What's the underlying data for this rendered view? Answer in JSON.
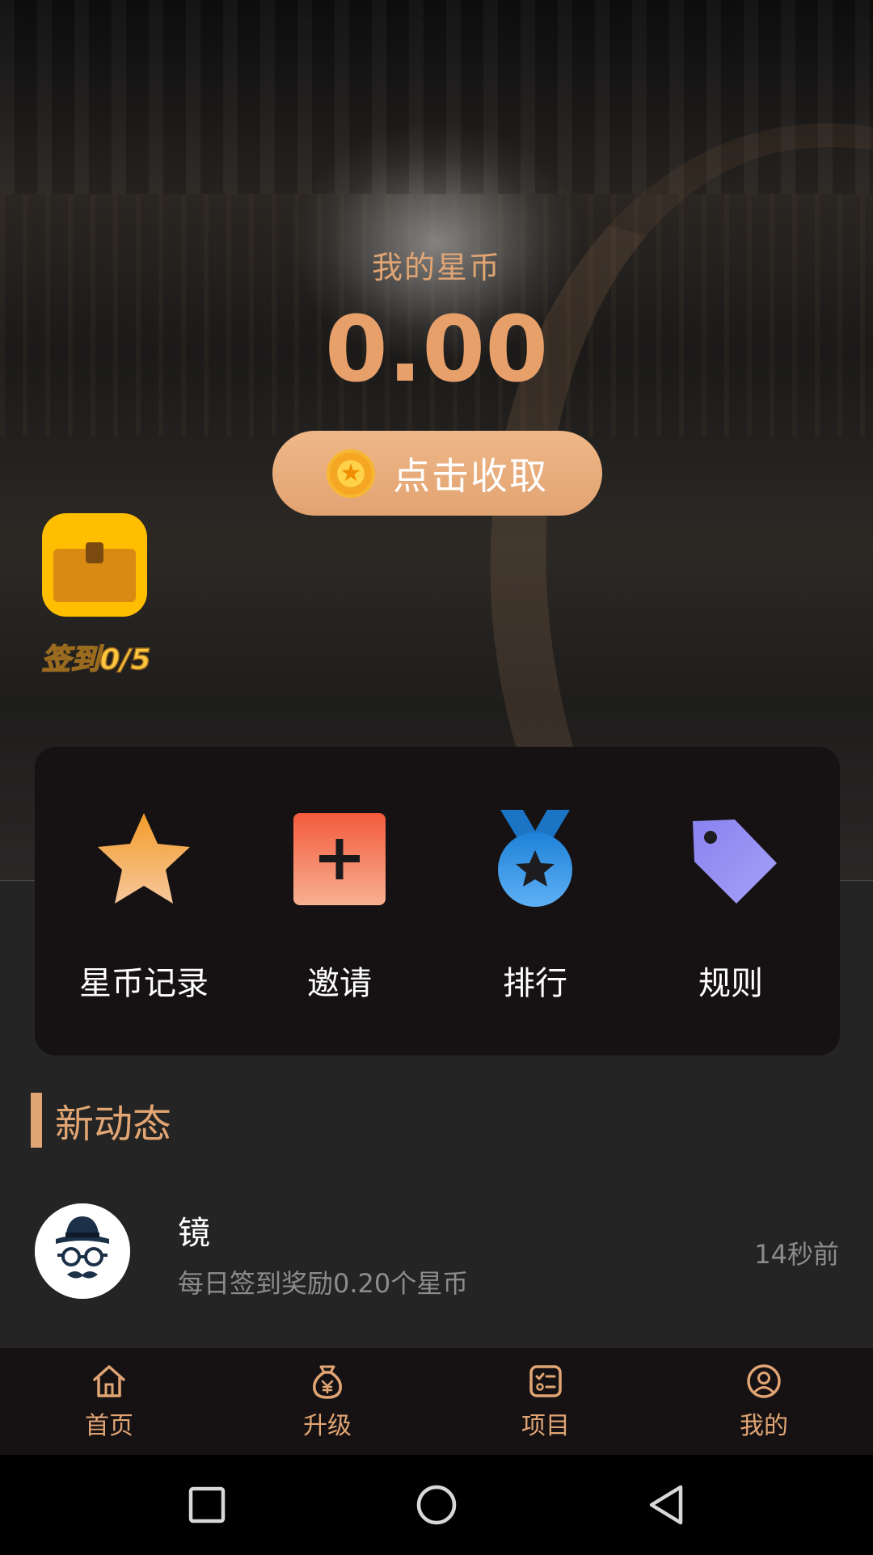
{
  "hero": {
    "stars_label": "我的星币",
    "stars_amount": "0.00",
    "collect_button": "点击收取",
    "checkin_label": "签到0/5"
  },
  "actions": [
    {
      "label": "星币记录",
      "icon": "star-icon"
    },
    {
      "label": "邀请",
      "icon": "plus-square-icon"
    },
    {
      "label": "排行",
      "icon": "medal-icon"
    },
    {
      "label": "规则",
      "icon": "tag-icon"
    }
  ],
  "feed": {
    "heading": "新动态",
    "items": [
      {
        "name": "镜",
        "description": "每日签到奖励0.20个星币",
        "time": "14秒前",
        "avatar": "spy-avatar"
      }
    ]
  },
  "tabbar": {
    "tabs": [
      {
        "label": "首页",
        "icon": "home-icon"
      },
      {
        "label": "升级",
        "icon": "money-bag-icon"
      },
      {
        "label": "项目",
        "icon": "checklist-icon"
      },
      {
        "label": "我的",
        "icon": "user-circle-icon"
      }
    ]
  },
  "colors": {
    "accent": "#e1a574",
    "background": "#242424",
    "card": "#161213"
  }
}
